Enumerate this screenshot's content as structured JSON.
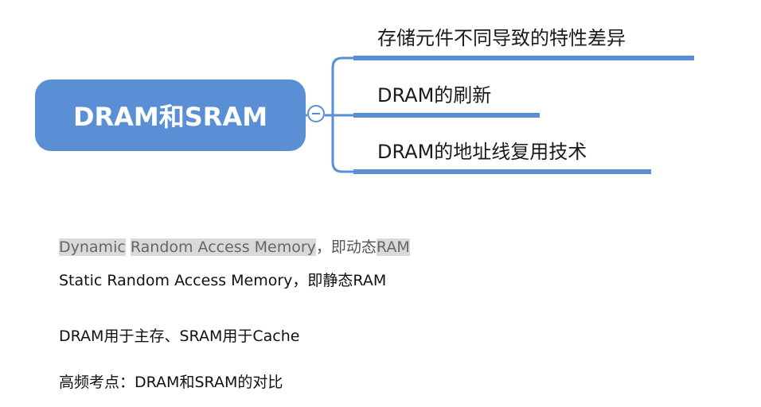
{
  "mindmap": {
    "root_label": "DRAM和SRAM",
    "branches": [
      {
        "label": "存储元件不同导致的特性差异"
      },
      {
        "label": "DRAM的刷新"
      },
      {
        "label": "DRAM的地址线复用技术"
      }
    ],
    "accent_color": "#5a8fd6"
  },
  "notes": {
    "line1": {
      "part1": "Dynamic",
      "part2": " ",
      "part3": "Random Access Memory",
      "part4": "，即动态",
      "part5": "RAM"
    },
    "line2": "Static Random Access Memory，即静态RAM",
    "line3": "DRAM用于主存、SRAM用于Cache",
    "line4": "高频考点：DRAM和SRAM的对比"
  }
}
